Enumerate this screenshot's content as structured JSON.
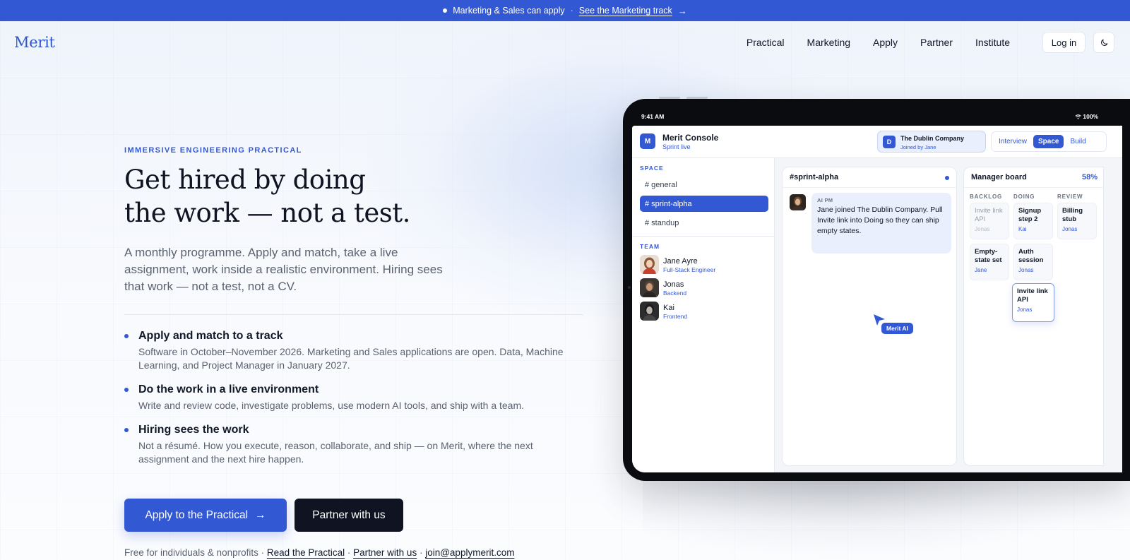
{
  "announcement": {
    "text": "Marketing & Sales can apply",
    "separator": "·",
    "link": "See the Marketing track",
    "arrow": "→"
  },
  "nav": {
    "logo": "Merit",
    "links": [
      "Practical",
      "Marketing",
      "Apply",
      "Partner",
      "Institute"
    ],
    "login": "Log in",
    "theme_icon": "moon-icon"
  },
  "hero": {
    "eyebrow": "IMMERSIVE ENGINEERING PRACTICAL",
    "headline_line1": "Get hired by doing",
    "headline_line2": "the work — not a test.",
    "lead": "A monthly programme. Apply and match, take a live assignment, work inside a realistic environment. Hiring sees that work — not a test, not a CV.",
    "features": [
      {
        "title": "Apply and match to a track",
        "desc": "Software in October–November 2026. Marketing and Sales applications are open. Data, Machine Learning, and Project Manager in January 2027."
      },
      {
        "title": "Do the work in a live environment",
        "desc": "Write and review code, investigate problems, use modern AI tools, and ship with a team."
      },
      {
        "title": "Hiring sees the work",
        "desc": "Not a résumé. How you execute, reason, collaborate, and ship — on Merit, where the next assignment and the next hire happen."
      }
    ],
    "cta_primary": "Apply to the Practical",
    "cta_primary_arrow": "→",
    "cta_secondary": "Partner with us",
    "footnote": {
      "prefix": "Free for individuals & nonprofits",
      "sep": " · ",
      "link1": "Read the Practical",
      "link2": "Partner with us",
      "link3": "join@applymerit.com"
    }
  },
  "tablet": {
    "time": "9:41 AM",
    "battery": "100%",
    "console": {
      "logo_letter": "M",
      "title": "Merit Console",
      "subtitle": "Sprint live",
      "company": {
        "letter": "D",
        "name": "The Dublin Company",
        "joined": "Joined by Jane"
      },
      "modes": [
        "Interview",
        "Space",
        "Build"
      ],
      "active_mode": "Space",
      "space_label": "SPACE",
      "channels": [
        "# general",
        "# sprint-alpha",
        "# standup"
      ],
      "team_label": "TEAM",
      "team": [
        {
          "name": "Jane Ayre",
          "role": "Full-Stack Engineer"
        },
        {
          "name": "Jonas",
          "role": "Backend"
        },
        {
          "name": "Kai",
          "role": "Frontend"
        }
      ],
      "chat": {
        "channel": "#sprint-alpha",
        "sender": "AI PM",
        "message": "Jane joined The Dublin Company. Pull Invite link into Doing so they can ship empty states.",
        "ai_tag": "Merit AI"
      },
      "board": {
        "title": "Manager board",
        "progress": "58%",
        "columns": [
          "BACKLOG",
          "DOING",
          "REVIEW"
        ],
        "cards": [
          {
            "title": "Invite link API",
            "assignee": "Jonas",
            "column": "BACKLOG"
          },
          {
            "title": "Empty-state set",
            "assignee": "Jane",
            "column": "BACKLOG"
          },
          {
            "title": "Signup step 2",
            "assignee": "Kai",
            "column": "DOING"
          },
          {
            "title": "Auth session",
            "assignee": "Jonas",
            "column": "DOING"
          },
          {
            "title": "Invite link API",
            "assignee": "Jonas",
            "column": "DOING"
          },
          {
            "title": "Billing stub",
            "assignee": "Jonas",
            "column": "REVIEW"
          }
        ]
      }
    }
  },
  "colors": {
    "accent": "#3358d4",
    "dark": "#0f1322",
    "muted": "#5b6270"
  }
}
